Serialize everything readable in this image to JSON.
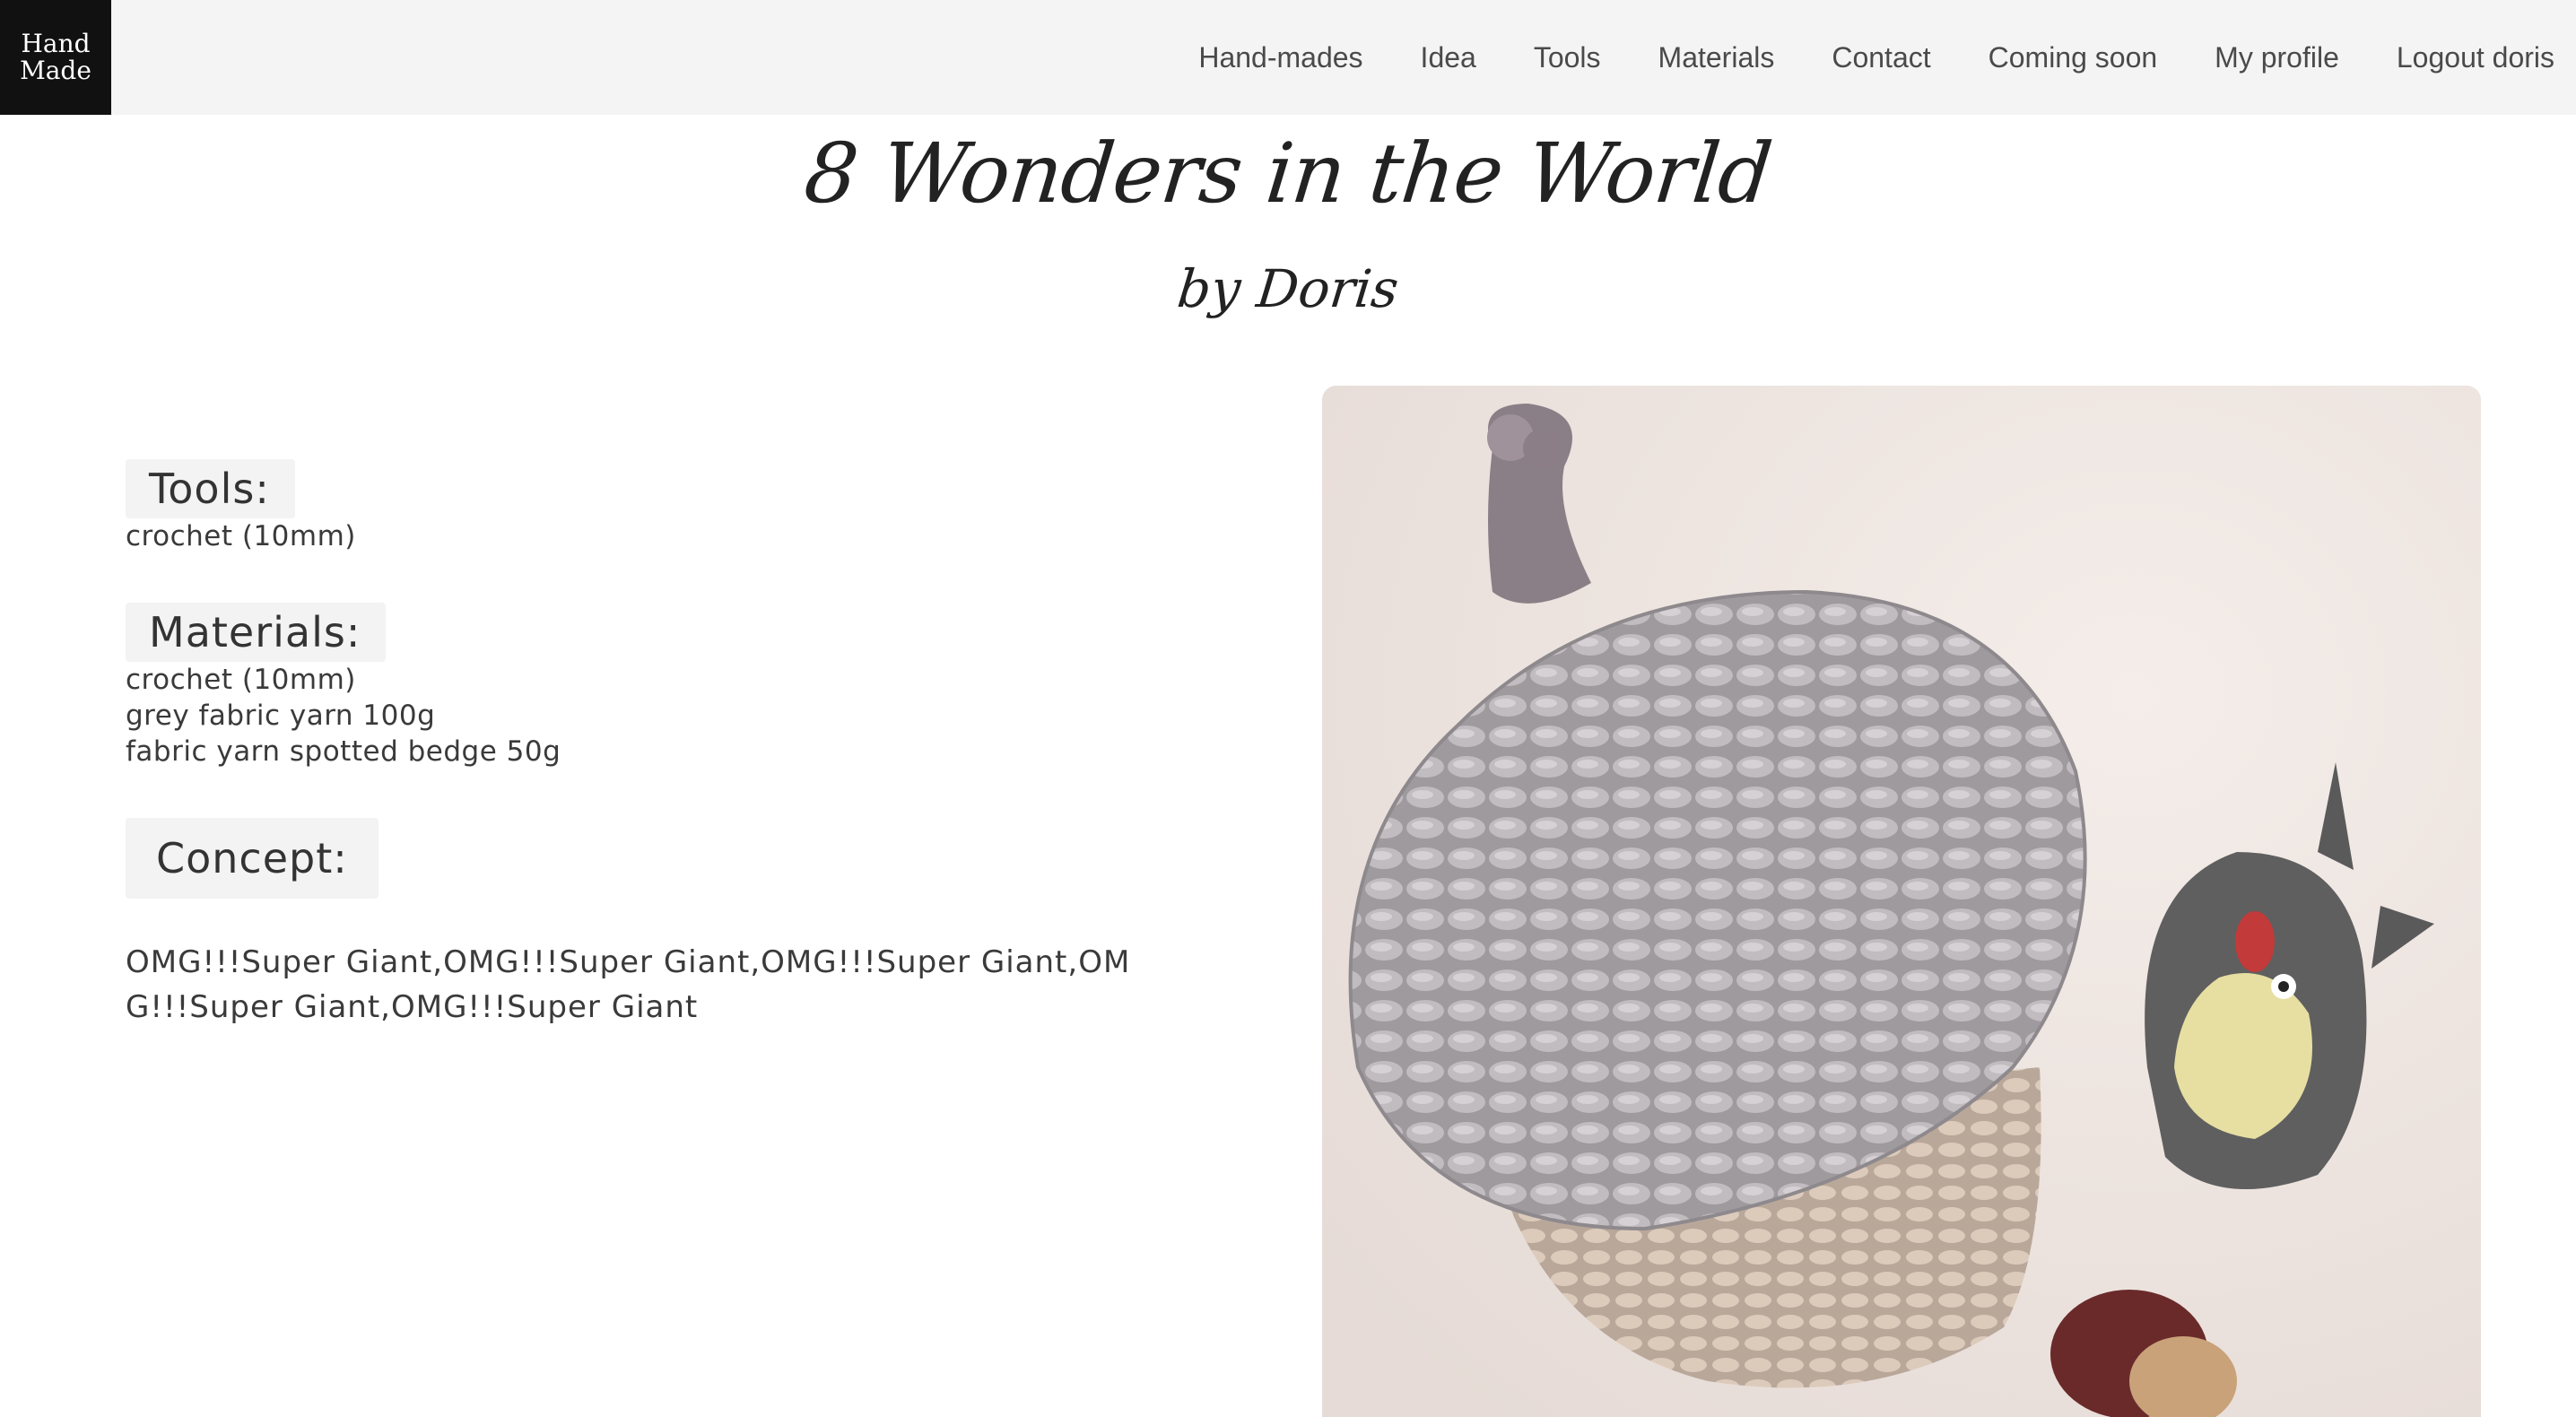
{
  "logo": {
    "line1": "Hand",
    "line2": "Made"
  },
  "nav": {
    "items": [
      "Hand-mades",
      "Idea",
      "Tools",
      "Materials",
      "Contact",
      "Coming soon",
      "My profile",
      "Logout doris"
    ]
  },
  "page": {
    "title": "8 Wonders in the World",
    "byline": "by Doris"
  },
  "sections": {
    "tools": {
      "label": "Tools:",
      "items": [
        "crochet (10mm)"
      ]
    },
    "materials": {
      "label": "Materials:",
      "items": [
        "crochet (10mm)",
        "grey fabric yarn 100g",
        "fabric yarn spotted bedge 50g"
      ]
    },
    "concept": {
      "label": "Concept:",
      "text": "OMG!!!Super Giant,OMG!!!Super Giant,OMG!!!Super Giant,OMG!!!Super Giant,OMG!!!Super Giant"
    }
  },
  "photo": {
    "subject": "crocheted acorn with figurine"
  },
  "colors": {
    "topbar_bg": "#f4f4f4",
    "logo_bg": "#111111",
    "chip_bg": "#f3f3f3",
    "text": "#333333"
  }
}
